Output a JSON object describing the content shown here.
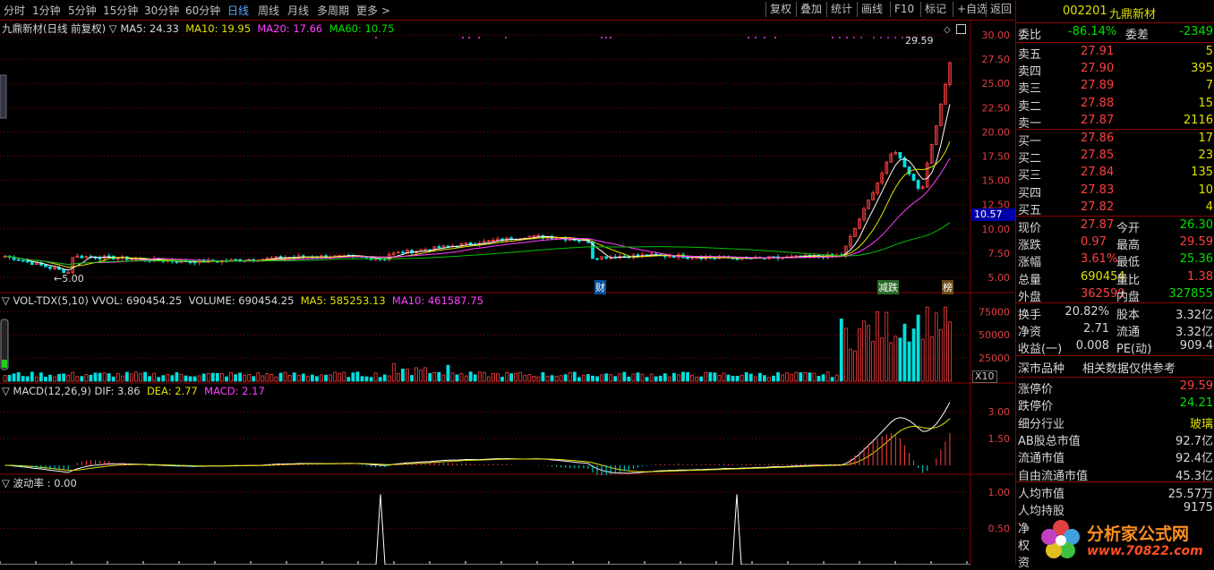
{
  "toolbar": {
    "periods": [
      "分时",
      "1分钟",
      "5分钟",
      "15分钟",
      "30分钟",
      "60分钟",
      "日线",
      "周线",
      "月线",
      "多周期",
      "更多"
    ],
    "active": "日线",
    "right_buttons": [
      "复权",
      "叠加",
      "统计",
      "画线",
      "F10",
      "标记",
      "+自选",
      "返回"
    ]
  },
  "main_chart": {
    "title": "九鼎新材(日线 前复权)",
    "ma5": "MA5: 24.33",
    "ma10": "MA10: 19.95",
    "ma20": "MA20: 17.66",
    "ma60": "MA60: 10.75",
    "y_ticks": [
      "30.00",
      "27.50",
      "25.00",
      "22.50",
      "20.00",
      "17.50",
      "15.00",
      "12.50",
      "10.00",
      "7.50",
      "5.00"
    ],
    "high_label": "29.59",
    "low_label": "5.00",
    "current_price_box": "10.57",
    "markers": [
      "财",
      "减跌",
      "榜"
    ]
  },
  "vol_chart": {
    "title": "VOL-TDX(5,10)",
    "vvol": "VVOL: 690454.25",
    "volume": "VOLUME: 690454.25",
    "ma5": "MA5: 585253.13",
    "ma10": "MA10: 461587.75",
    "y_ticks": [
      "75000",
      "50000",
      "25000"
    ],
    "unit": "X10"
  },
  "macd_chart": {
    "title": "MACD(12,26,9)",
    "dif": "DIF: 3.86",
    "dea": "DEA: 2.77",
    "macd": "MACD: 2.17",
    "y_ticks": [
      "3.00",
      "1.50"
    ]
  },
  "vol_rate_chart": {
    "title": "波动率 : 0.00",
    "y_ticks": [
      "1.00",
      "0.50"
    ]
  },
  "quote": {
    "code": "002201",
    "name": "九鼎新材",
    "wei_bi_label": "委比",
    "wei_bi": "-86.14%",
    "wei_cha_label": "委差",
    "wei_cha": "-2349",
    "asks": [
      {
        "label": "卖五",
        "price": "27.91",
        "vol": "5"
      },
      {
        "label": "卖四",
        "price": "27.90",
        "vol": "395"
      },
      {
        "label": "卖三",
        "price": "27.89",
        "vol": "7"
      },
      {
        "label": "卖二",
        "price": "27.88",
        "vol": "15"
      },
      {
        "label": "卖一",
        "price": "27.87",
        "vol": "2116"
      }
    ],
    "bids": [
      {
        "label": "买一",
        "price": "27.86",
        "vol": "17"
      },
      {
        "label": "买二",
        "price": "27.85",
        "vol": "23"
      },
      {
        "label": "买三",
        "price": "27.84",
        "vol": "135"
      },
      {
        "label": "买四",
        "price": "27.83",
        "vol": "10"
      },
      {
        "label": "买五",
        "price": "27.82",
        "vol": "4"
      }
    ],
    "stats": [
      {
        "l1": "现价",
        "v1": "27.87",
        "l2": "今开",
        "v2": "26.30"
      },
      {
        "l1": "涨跌",
        "v1": "0.97",
        "l2": "最高",
        "v2": "29.59"
      },
      {
        "l1": "涨幅",
        "v1": "3.61%",
        "l2": "最低",
        "v2": "25.36"
      },
      {
        "l1": "总量",
        "v1": "690454",
        "l2": "量比",
        "v2": "1.38"
      },
      {
        "l1": "外盘",
        "v1": "362599",
        "l2": "内盘",
        "v2": "327855"
      }
    ],
    "fin": [
      {
        "l1": "换手",
        "v1": "20.82%",
        "l2": "股本",
        "v2": "3.32亿"
      },
      {
        "l1": "净资",
        "v1": "2.71",
        "l2": "流通",
        "v2": "3.32亿"
      },
      {
        "l1": "收益(一)",
        "v1": "0.008",
        "l2": "PE(动)",
        "v2": "909.4"
      }
    ],
    "market_note_1": "深市品种",
    "market_note_2": "相关数据仅供参考",
    "limits": [
      {
        "label": "涨停价",
        "value": "29.59"
      },
      {
        "label": "跌停价",
        "value": "24.21"
      },
      {
        "label": "细分行业",
        "value": "玻璃"
      },
      {
        "label": "AB股总市值",
        "value": "92.7亿"
      },
      {
        "label": "流通市值",
        "value": "92.4亿"
      },
      {
        "label": "自由流通市值",
        "value": "45.3亿"
      }
    ],
    "extra": [
      {
        "label": "人均市值",
        "value": "25.57万"
      },
      {
        "label": "人均持股",
        "value": "9175"
      },
      {
        "label": "净",
        "value": ""
      },
      {
        "label": "权",
        "value": ""
      },
      {
        "label": "资",
        "value": ""
      }
    ]
  },
  "watermark": {
    "brand": "分析家公式网",
    "url": "www.70822.com"
  },
  "colors": {
    "up": "#ff4040",
    "down": "#00e0e0",
    "ma5": "#ffffff",
    "ma10": "#e0e000",
    "ma20": "#ff40ff",
    "ma60": "#00c000",
    "grid": "#8b0000"
  }
}
